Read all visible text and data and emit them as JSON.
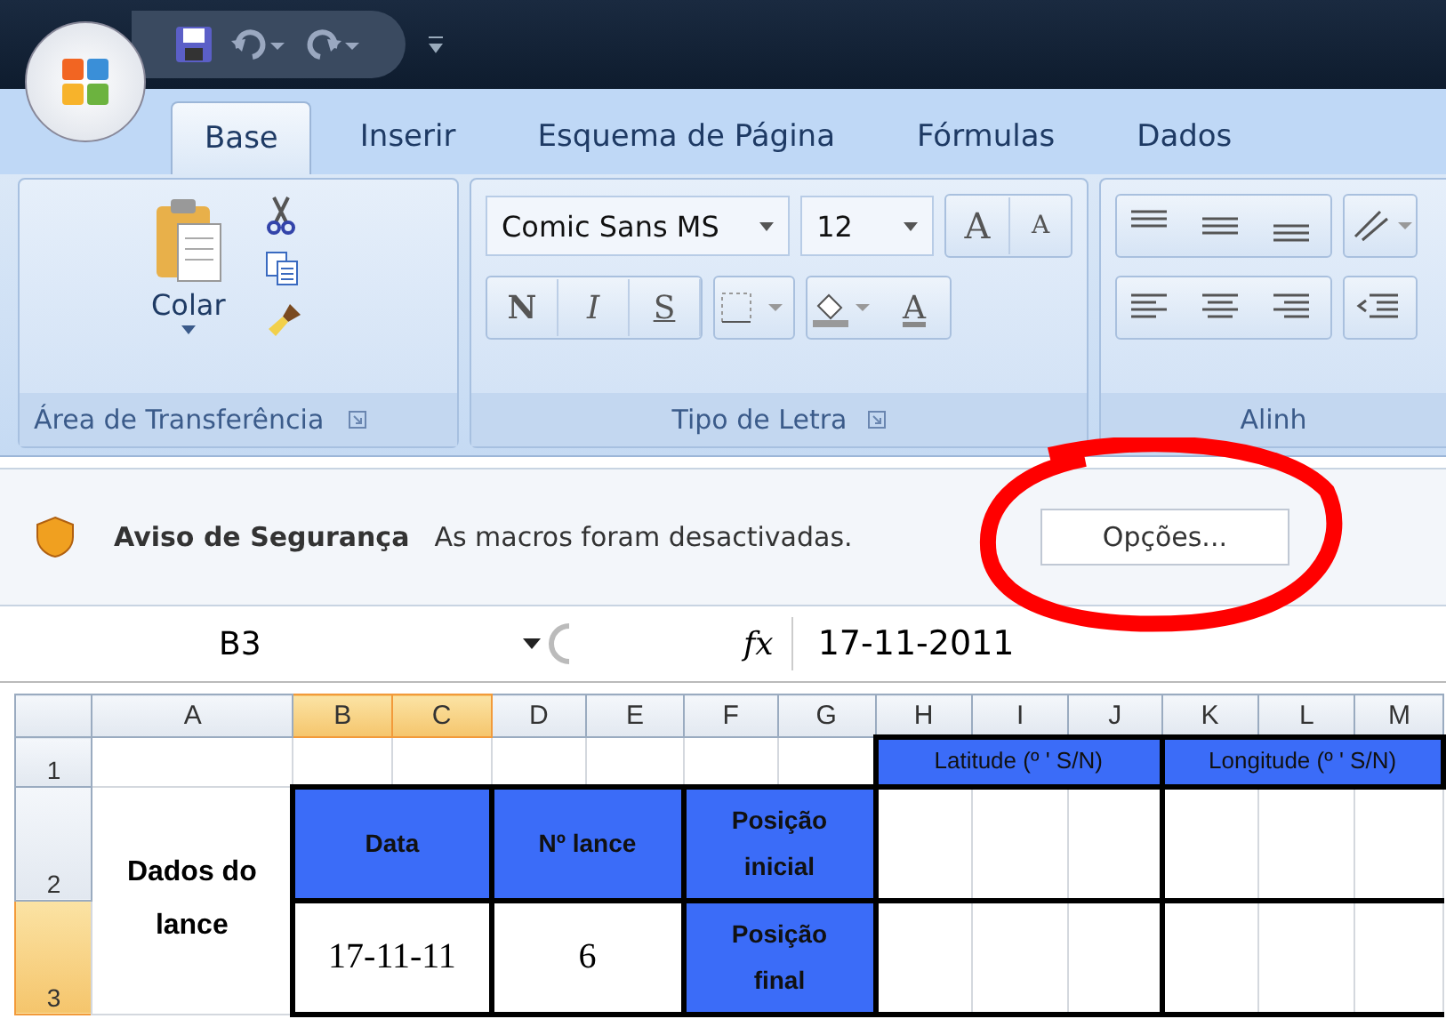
{
  "tabs": [
    {
      "label": "Base",
      "selected": true
    },
    {
      "label": "Inserir",
      "selected": false
    },
    {
      "label": "Esquema de Página",
      "selected": false
    },
    {
      "label": "Fórmulas",
      "selected": false
    },
    {
      "label": "Dados",
      "selected": false
    }
  ],
  "ribbon": {
    "clipboard": {
      "paste_label": "Colar",
      "title": "Área de Transferência"
    },
    "font": {
      "family": "Comic Sans MS",
      "size": "12",
      "grow": "A",
      "shrink": "A",
      "styles": [
        "N",
        "I",
        "S"
      ],
      "color_glyph": "A",
      "title": "Tipo de Letra"
    },
    "alignment": {
      "title": "Alinh"
    }
  },
  "security_bar": {
    "title": "Aviso de Segurança",
    "message": "As macros foram desactivadas.",
    "button": "Opções..."
  },
  "formula_bar": {
    "name_box": "B3",
    "function_label": "fx",
    "value": "17-11-2011"
  },
  "sheet": {
    "columns": [
      {
        "label": "A",
        "selected": false
      },
      {
        "label": "B",
        "selected": true
      },
      {
        "label": "C",
        "selected": true
      },
      {
        "label": "D",
        "selected": false
      },
      {
        "label": "E",
        "selected": false
      },
      {
        "label": "F",
        "selected": false
      },
      {
        "label": "G",
        "selected": false
      },
      {
        "label": "H",
        "selected": false
      },
      {
        "label": "I",
        "selected": false
      },
      {
        "label": "J",
        "selected": false
      },
      {
        "label": "K",
        "selected": false
      },
      {
        "label": "L",
        "selected": false
      },
      {
        "label": "M",
        "selected": false
      }
    ],
    "rows": [
      {
        "label": "1",
        "selected": false
      },
      {
        "label": "2",
        "selected": false
      },
      {
        "label": "3",
        "selected": true
      }
    ],
    "latitude_header": "Latitude (º ' S/N)",
    "longitude_header": "Longitude (º ' S/N)",
    "row_label": "Dados do lance",
    "date_header": "Data",
    "number_header": "Nº lance",
    "start_header": "Posição inicial",
    "end_header": "Posição final",
    "date_value": "17-11-11",
    "number_value": "6"
  }
}
